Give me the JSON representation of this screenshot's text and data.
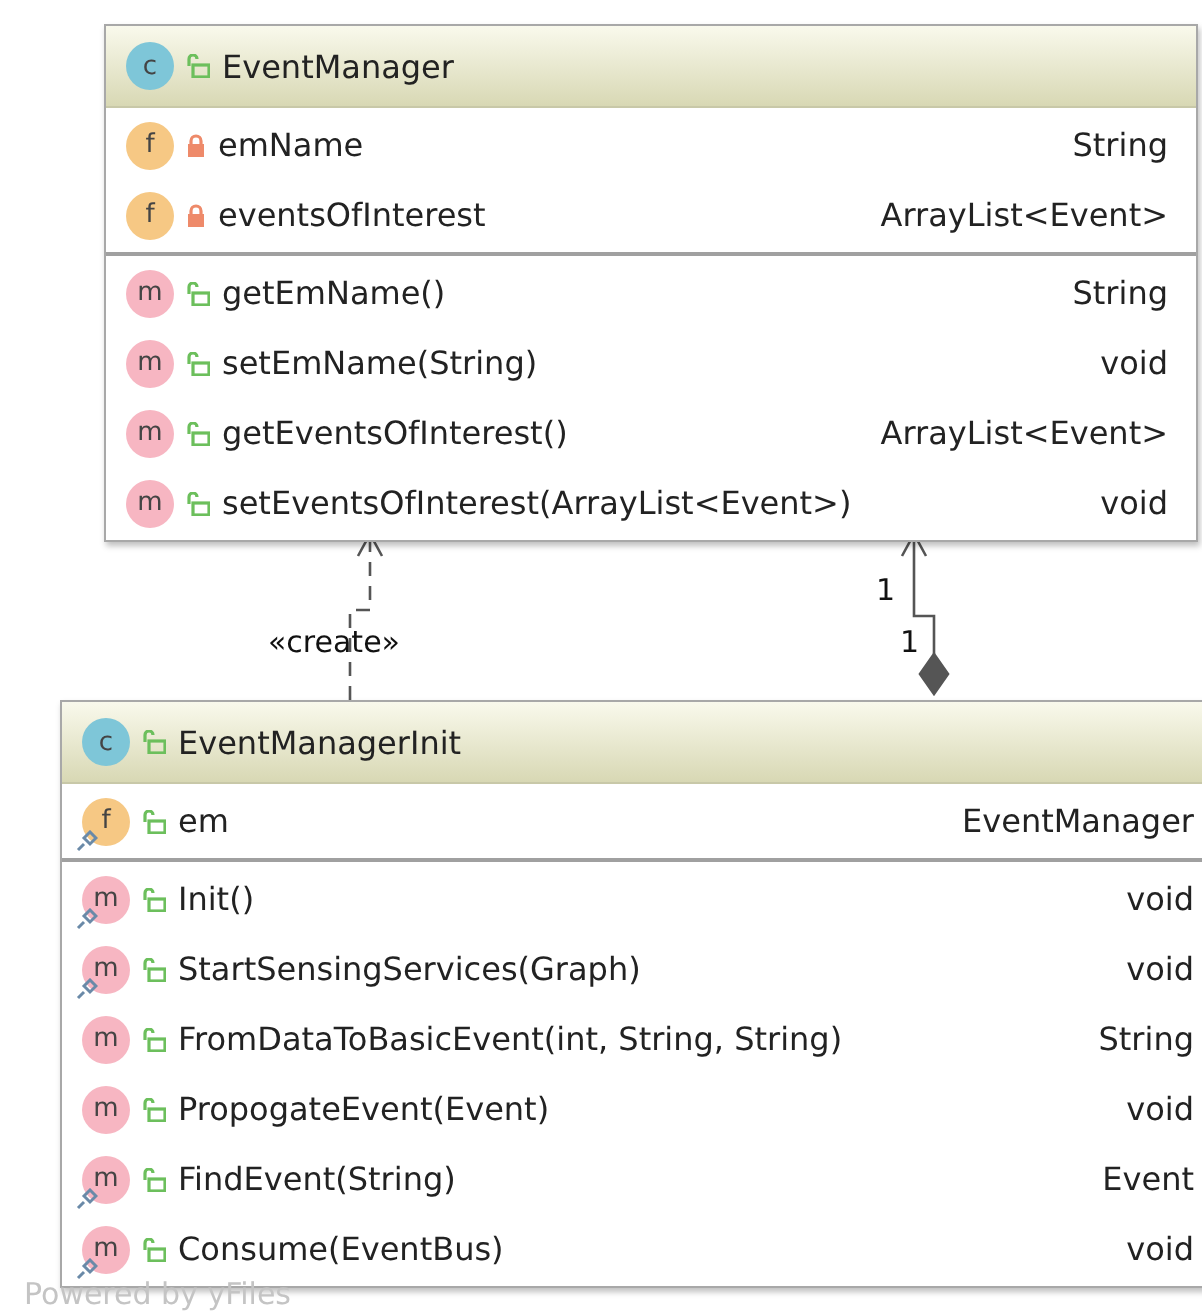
{
  "classes": [
    {
      "badge": "c",
      "name": "EventManager",
      "locked": false,
      "fields": [
        {
          "badge": "f",
          "name": "emName",
          "type": "String",
          "locked": true,
          "pin_marker": false
        },
        {
          "badge": "f",
          "name": "eventsOfInterest",
          "type": "ArrayList<Event>",
          "locked": true,
          "pin_marker": false
        }
      ],
      "methods": [
        {
          "badge": "m",
          "name": "getEmName()",
          "type": "String",
          "locked": false,
          "pin_marker": false
        },
        {
          "badge": "m",
          "name": "setEmName(String)",
          "type": "void",
          "locked": false,
          "pin_marker": false
        },
        {
          "badge": "m",
          "name": "getEventsOfInterest()",
          "type": "ArrayList<Event>",
          "locked": false,
          "pin_marker": false
        },
        {
          "badge": "m",
          "name": "setEventsOfInterest(ArrayList<Event>)",
          "type": "void",
          "locked": false,
          "pin_marker": false
        }
      ]
    },
    {
      "badge": "c",
      "name": "EventManagerInit",
      "locked": false,
      "fields": [
        {
          "badge": "f",
          "name": "em",
          "type": "EventManager",
          "locked": false,
          "pin_marker": true
        }
      ],
      "methods": [
        {
          "badge": "m",
          "name": "Init()",
          "type": "void",
          "locked": false,
          "pin_marker": true
        },
        {
          "badge": "m",
          "name": "StartSensingServices(Graph)",
          "type": "void",
          "locked": false,
          "pin_marker": true
        },
        {
          "badge": "m",
          "name": "FromDataToBasicEvent(int, String, String)",
          "type": "String",
          "locked": false,
          "pin_marker": false
        },
        {
          "badge": "m",
          "name": "PropogateEvent(Event)",
          "type": "void",
          "locked": false,
          "pin_marker": false
        },
        {
          "badge": "m",
          "name": "FindEvent(String)",
          "type": "Event",
          "locked": false,
          "pin_marker": true
        },
        {
          "badge": "m",
          "name": "Consume(EventBus)",
          "type": "void",
          "locked": false,
          "pin_marker": true
        }
      ]
    }
  ],
  "connectors": [
    {
      "kind": "dependency",
      "label": "«create»"
    },
    {
      "kind": "composition",
      "target_multiplicity": "1",
      "source_multiplicity": "1"
    }
  ],
  "footer": "Powered by yFiles"
}
